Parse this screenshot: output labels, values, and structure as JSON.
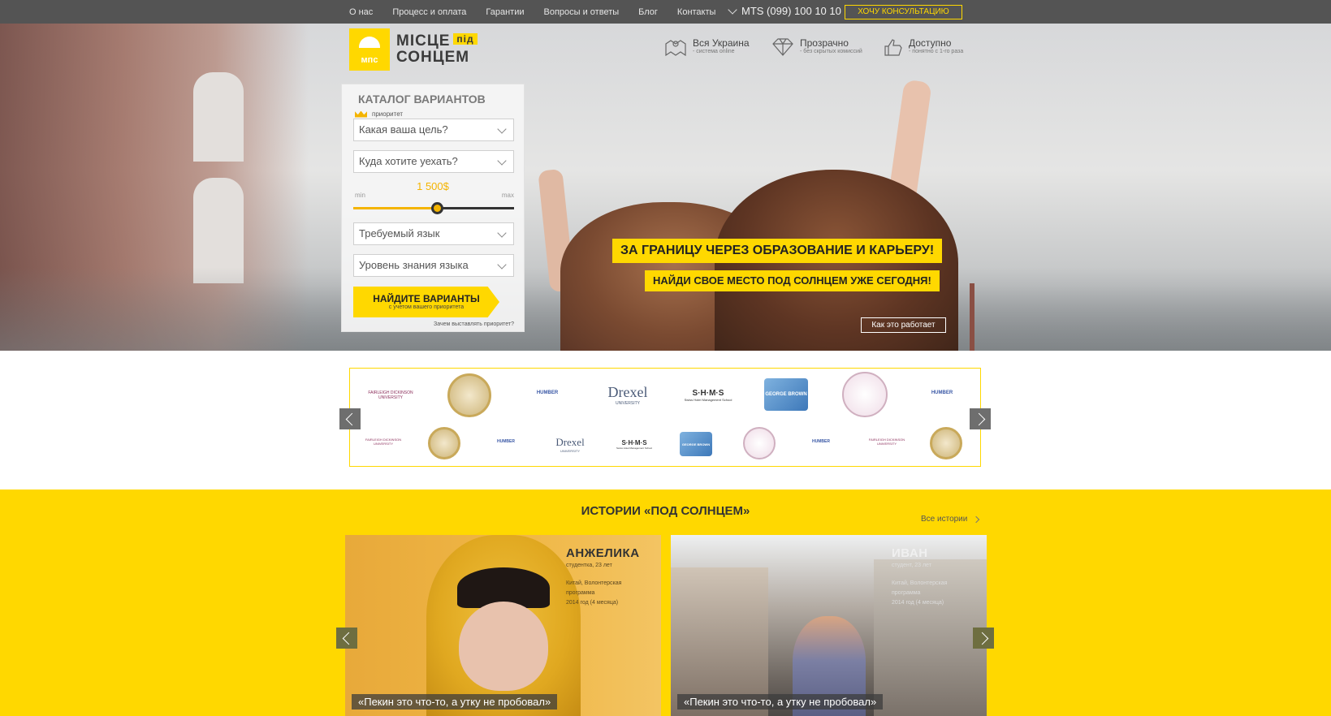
{
  "nav": {
    "items": [
      "О нас",
      "Процесс и оплата",
      "Гарантии",
      "Вопросы и ответы",
      "Блог",
      "Контакты"
    ],
    "phone": "MTS (099) 100 10 10",
    "cta": "ХОЧУ КОНСУЛЬТАЦИЮ"
  },
  "logo": {
    "line1": "МІСЦЕ",
    "pid": "під",
    "line2": "СОНЦЕМ",
    "mark_text": "мпс"
  },
  "features": [
    {
      "title": "Вся Украина",
      "sub": "- система online",
      "icon": "map-icon"
    },
    {
      "title": "Прозрачно",
      "sub": "- без скрытых комиссий",
      "icon": "diamond-icon"
    },
    {
      "title": "Доступно",
      "sub": "- понятно с 1-го раза",
      "icon": "thumbs-up-icon"
    }
  ],
  "catalog": {
    "title": "КАТАЛОГ ВАРИАНТОВ",
    "priority": "приоритет",
    "goal": "Какая ваша цель?",
    "destination": "Куда хотите уехать?",
    "price": "1 500$",
    "min": "min",
    "max": "max",
    "slider_fraction": 0.52,
    "language": "Требуемый язык",
    "level": "Уровень знания языка",
    "find_btn": "НАЙДИТЕ ВАРИАНТЫ",
    "find_sub": "с учетом вашего приоритета",
    "why": "Зачем выставлять приоритет?"
  },
  "hero": {
    "headline": "ЗА ГРАНИЦУ ЧЕРЕЗ ОБРАЗОВАНИЕ И КАРЬЕРУ!",
    "subline": "НАЙДИ СВОЕ МЕСТО ПОД СОЛНЦЕМ УЖЕ СЕГОДНЯ!",
    "how": "Как это работает"
  },
  "universities": {
    "fdu": "FAIRLEIGH DICKINSON",
    "fdu_sub": "UNIVERSITY",
    "humber": "HUMBER",
    "drexel": "Drexel",
    "drexel_sub": "UNIVERSITY",
    "shms": "S·H·M·S",
    "shms_sub": "Swiss Hotel Management School",
    "gbrown": "GEORGE BROWN"
  },
  "stories": {
    "title": "ИСТОРИИ «ПОД СОЛНЦЕМ»",
    "all": "Все истории",
    "cards": [
      {
        "name": "АНЖЕЛИКА",
        "age": "студентка, 23 лет",
        "place": "Китай, Волонтерская",
        "program": "программа",
        "period": "2014 год (4 месяца)",
        "quote": "«Пекин это что-то, а утку не пробовал»"
      },
      {
        "name": "ИВАН",
        "age": "студент, 23 лет",
        "place": "Китай, Волонтерская",
        "program": "программа",
        "period": "2014 год (4 месяца)",
        "quote": "«Пекин это что-то, а утку не пробовал»"
      }
    ]
  },
  "colors": {
    "accent": "#ffd800",
    "topbar": "#545454"
  }
}
